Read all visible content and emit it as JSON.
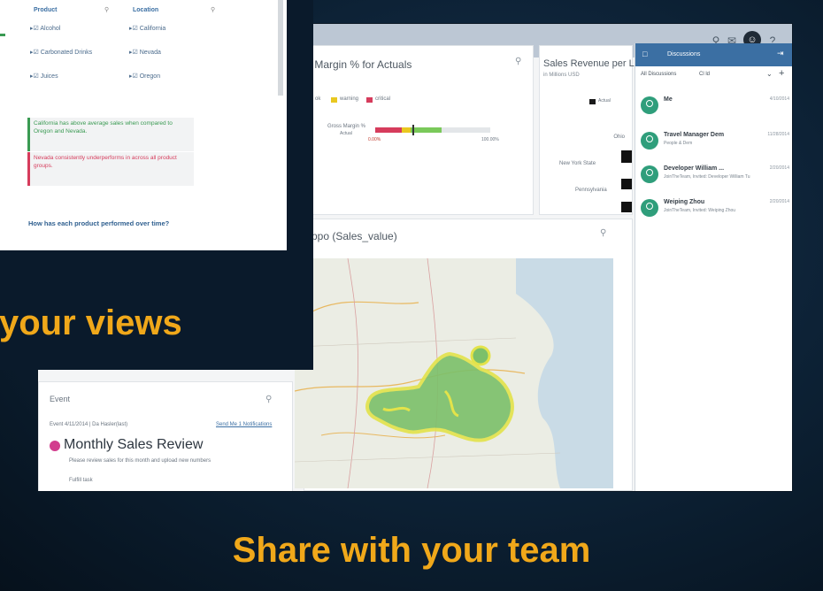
{
  "headline_bottom": "Share with your team",
  "headline_overlay": "your views",
  "app": {
    "accent": "#3b6fa3",
    "gauge_card": {
      "title": "s Margin % for Actuals",
      "legend": [
        "ok",
        "warning",
        "critical"
      ],
      "row_label": "Gross Margin %",
      "row_sub": "Actual",
      "axis_start": "0.00%",
      "axis_end": "100.00%",
      "progress": 0.32
    },
    "revenue_card": {
      "title": "Sales Revenue per L",
      "subtitle": "in Millions USD",
      "legend": "Actual",
      "rows": [
        "Ohio",
        "New York State",
        "Pennsylvania"
      ]
    },
    "map_card": {
      "title": "ppo (Sales_value)"
    },
    "event_card": {
      "header": "Event",
      "meta": "Event 4/11/2014 | Da Hasler(last)",
      "meta_link": "Send Me 1 Notifications",
      "title": "Monthly Sales Review",
      "desc": "Please review sales for this month and upload new numbers",
      "footer": "Fulfill task"
    },
    "discussions": {
      "header": "Discussions",
      "count": "All Discussions",
      "filter": "Cl ld",
      "items": [
        {
          "name": "Me",
          "sub": "",
          "date": "4/10/2014"
        },
        {
          "name": "Travel Manager Dem",
          "sub": "People & Dem",
          "date": "11/28/2014"
        },
        {
          "name": "Developer William ...",
          "sub": "JoinTheTeam, Invited: Developer William Tu",
          "date": "2/20/2014"
        },
        {
          "name": "Weiping Zhou",
          "sub": "JoinTheTeam, Invited: Weiping Zhou",
          "date": "2/20/2014"
        }
      ]
    }
  },
  "overlay_panel": {
    "filters": {
      "product_header": "Product",
      "location_header": "Location",
      "products": [
        "Alcohol",
        "Carbonated Drinks",
        "Juices"
      ],
      "locations": [
        "California",
        "Nevada",
        "Oregon"
      ]
    },
    "notes": [
      {
        "text": "California has above average sales when compared to Oregon and Nevada.",
        "color": "#3a9a52",
        "bar": "#3a9a52"
      },
      {
        "text": "Nevada consistently underperforms in across all product groups.",
        "color": "#d63c5c",
        "bar": "#d63c5c"
      }
    ],
    "question": "How has each product performed over time?"
  }
}
